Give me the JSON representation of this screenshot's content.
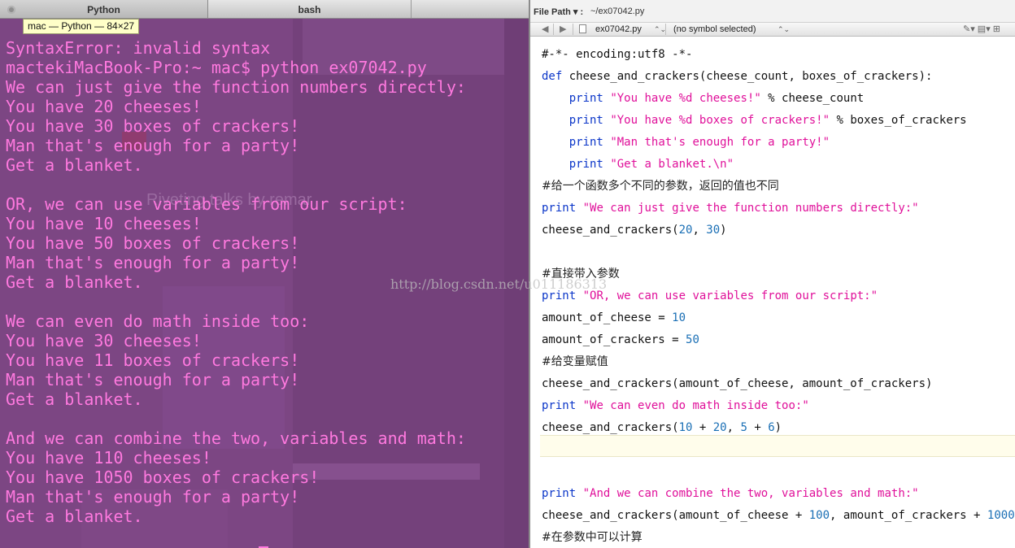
{
  "terminal": {
    "tabs": [
      {
        "label": "Python",
        "active": true
      },
      {
        "label": "bash",
        "active": false
      }
    ],
    "tooltip": "mac — Python — 84×27",
    "text_color": "#ff79df",
    "background_color": "#7a4580",
    "output_lines": [
      "SyntaxError: invalid syntax",
      "mactekiMacBook-Pro:~ mac$ python ex07042.py",
      "We can just give the function numbers directly:",
      "You have 20 cheeses!",
      "You have 30 boxes of crackers!",
      "Man that's enough for a party!",
      "Get a blanket.",
      "",
      "OR, we can use variables from our script:",
      "You have 10 cheeses!",
      "You have 50 boxes of crackers!",
      "Man that's enough for a party!",
      "Get a blanket.",
      "",
      "We can even do math inside too:",
      "You have 30 cheeses!",
      "You have 11 boxes of crackers!",
      "Man that's enough for a party!",
      "Get a blanket.",
      "",
      "And we can combine the two, variables and math:",
      "You have 110 cheeses!",
      "You have 1050 boxes of crackers!",
      "Man that's enough for a party!",
      "Get a blanket."
    ]
  },
  "editor": {
    "path_label": "File Path ▾ :",
    "path_value": "~/ex07042.py",
    "jump_bar": {
      "back": "◀",
      "forward": "▶",
      "file": "ex07042.py",
      "symbol": "(no symbol selected)",
      "updown": "⌃⌄",
      "right_icons": "✎▾  ▤▾  ⊞"
    },
    "code_lines": [
      [
        {
          "t": "#-*- encoding:utf8 -*-",
          "c": "plain"
        }
      ],
      [
        {
          "t": "def",
          "c": "kw"
        },
        {
          "t": " cheese_and_crackers(cheese_count, boxes_of_crackers):",
          "c": "plain"
        }
      ],
      [
        {
          "t": "    ",
          "c": "plain"
        },
        {
          "t": "print",
          "c": "kw"
        },
        {
          "t": " ",
          "c": "plain"
        },
        {
          "t": "\"You have %d cheeses!\"",
          "c": "str"
        },
        {
          "t": " % cheese_count",
          "c": "plain"
        }
      ],
      [
        {
          "t": "    ",
          "c": "plain"
        },
        {
          "t": "print",
          "c": "kw"
        },
        {
          "t": " ",
          "c": "plain"
        },
        {
          "t": "\"You have %d boxes of crackers!\"",
          "c": "str"
        },
        {
          "t": " % boxes_of_crackers",
          "c": "plain"
        }
      ],
      [
        {
          "t": "    ",
          "c": "plain"
        },
        {
          "t": "print",
          "c": "kw"
        },
        {
          "t": " ",
          "c": "plain"
        },
        {
          "t": "\"Man that's enough for a party!\"",
          "c": "str"
        }
      ],
      [
        {
          "t": "    ",
          "c": "plain"
        },
        {
          "t": "print",
          "c": "kw"
        },
        {
          "t": " ",
          "c": "plain"
        },
        {
          "t": "\"Get a blanket.\\n\"",
          "c": "str"
        }
      ],
      [
        {
          "t": "#给一个函数多个不同的参数，返回的值也不同",
          "c": "cm"
        }
      ],
      [
        {
          "t": "print",
          "c": "kw"
        },
        {
          "t": " ",
          "c": "plain"
        },
        {
          "t": "\"We can just give the function numbers directly:\"",
          "c": "str"
        }
      ],
      [
        {
          "t": "cheese_and_crackers(",
          "c": "plain"
        },
        {
          "t": "20",
          "c": "num"
        },
        {
          "t": ", ",
          "c": "plain"
        },
        {
          "t": "30",
          "c": "num"
        },
        {
          "t": ")",
          "c": "plain"
        }
      ],
      [],
      [
        {
          "t": "#直接带入参数",
          "c": "cm"
        }
      ],
      [
        {
          "t": "print",
          "c": "kw"
        },
        {
          "t": " ",
          "c": "plain"
        },
        {
          "t": "\"OR, we can use variables from our script:\"",
          "c": "str"
        }
      ],
      [
        {
          "t": "amount_of_cheese = ",
          "c": "plain"
        },
        {
          "t": "10",
          "c": "num"
        }
      ],
      [
        {
          "t": "amount_of_crackers = ",
          "c": "plain"
        },
        {
          "t": "50",
          "c": "num"
        }
      ],
      [
        {
          "t": "#给变量赋值",
          "c": "cm"
        }
      ],
      [
        {
          "t": "cheese_and_crackers(amount_of_cheese, amount_of_crackers)",
          "c": "plain"
        }
      ],
      [
        {
          "t": "print",
          "c": "kw"
        },
        {
          "t": " ",
          "c": "plain"
        },
        {
          "t": "\"We can even do math inside too:\"",
          "c": "str"
        }
      ],
      [
        {
          "t": "cheese_and_crackers(",
          "c": "plain"
        },
        {
          "t": "10",
          "c": "num"
        },
        {
          "t": " + ",
          "c": "plain"
        },
        {
          "t": "20",
          "c": "num"
        },
        {
          "t": ", ",
          "c": "plain"
        },
        {
          "t": "5",
          "c": "num"
        },
        {
          "t": " + ",
          "c": "plain"
        },
        {
          "t": "6",
          "c": "num"
        },
        {
          "t": ")",
          "c": "plain"
        }
      ],
      [],
      [],
      [
        {
          "t": "print",
          "c": "kw"
        },
        {
          "t": " ",
          "c": "plain"
        },
        {
          "t": "\"And we can combine the two, variables and math:\"",
          "c": "str"
        }
      ],
      [
        {
          "t": "cheese_and_crackers(amount_of_cheese + ",
          "c": "plain"
        },
        {
          "t": "100",
          "c": "num"
        },
        {
          "t": ", amount_of_crackers + ",
          "c": "plain"
        },
        {
          "t": "1000",
          "c": "num"
        },
        {
          "t": ")",
          "c": "plain"
        }
      ],
      [
        {
          "t": "#在参数中可以计算",
          "c": "cm"
        }
      ]
    ],
    "current_line_index": 18
  },
  "watermark": "http://blog.csdn.net/u011186313"
}
